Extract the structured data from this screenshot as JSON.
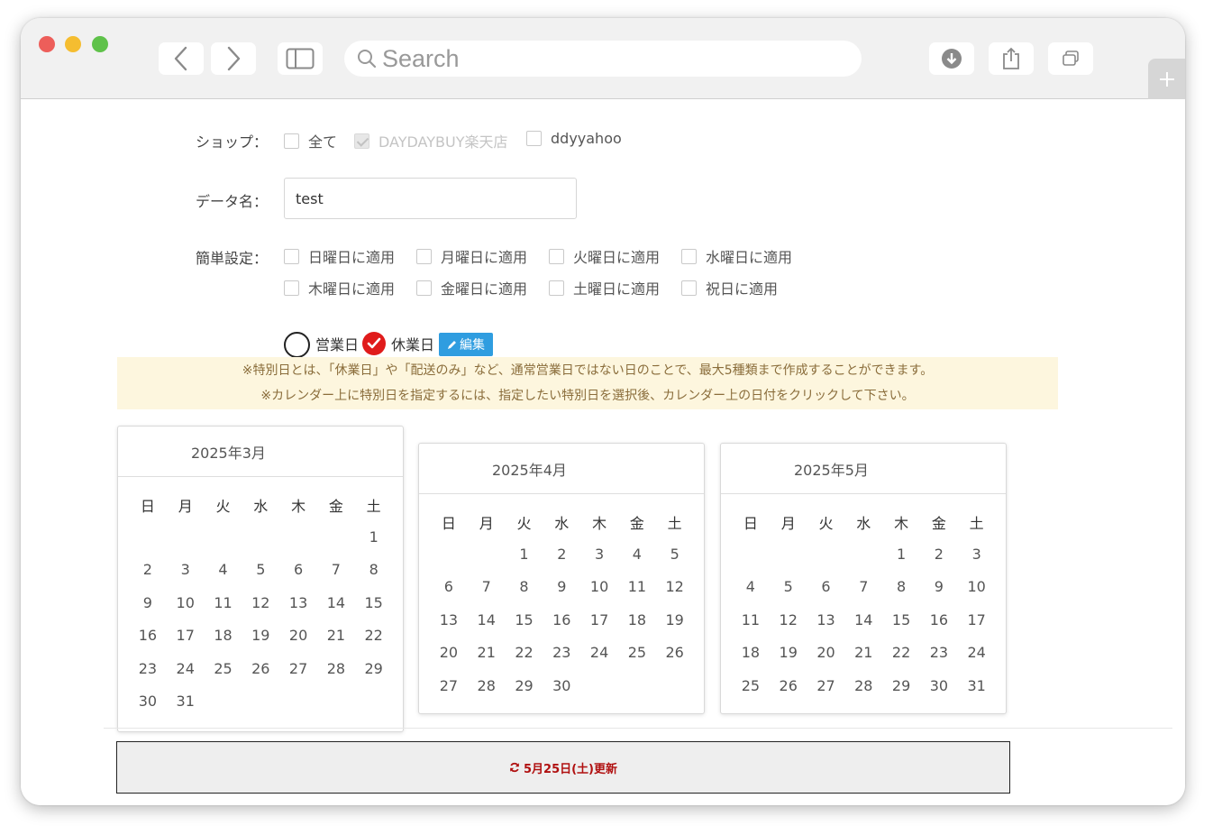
{
  "browser": {
    "search_placeholder": "Search"
  },
  "form": {
    "shop_label": "ショップ：",
    "shop_options": [
      {
        "label": "全て",
        "checked": false,
        "disabled": false
      },
      {
        "label": "DAYDAYBUY楽天店",
        "checked": true,
        "disabled": true
      },
      {
        "label": "ddyyahoo",
        "checked": false,
        "disabled": false
      }
    ],
    "data_name_label": "データ名：",
    "data_name_value": "test",
    "simple_setting_label": "簡単設定：",
    "simple_options": [
      "日曜日に適用",
      "月曜日に適用",
      "火曜日に適用",
      "水曜日に適用",
      "木曜日に適用",
      "金曜日に適用",
      "土曜日に適用",
      "祝日に適用"
    ],
    "day_type_business": "営業日",
    "day_type_holiday": "休業日",
    "day_type_selected": "休業日",
    "edit_button": "編集"
  },
  "notice": {
    "line1": "※特別日とは、「休業日」や「配送のみ」など、通常営業日ではない日のことで、最大5種類まで作成することができます。",
    "line2": "※カレンダー上に特別日を指定するには、指定したい特別日を選択後、カレンダー上の日付をクリックして下さい。"
  },
  "calendars": [
    {
      "title": "2025年3月",
      "weekdays": [
        "日",
        "月",
        "火",
        "水",
        "木",
        "金",
        "土"
      ],
      "weeks": [
        [
          "",
          "",
          "",
          "",
          "",
          "",
          "1"
        ],
        [
          "2",
          "3",
          "4",
          "5",
          "6",
          "7",
          "8"
        ],
        [
          "9",
          "10",
          "11",
          "12",
          "13",
          "14",
          "15"
        ],
        [
          "16",
          "17",
          "18",
          "19",
          "20",
          "21",
          "22"
        ],
        [
          "23",
          "24",
          "25",
          "26",
          "27",
          "28",
          "29"
        ],
        [
          "30",
          "31",
          "",
          "",
          "",
          "",
          ""
        ]
      ]
    },
    {
      "title": "2025年4月",
      "weekdays": [
        "日",
        "月",
        "火",
        "水",
        "木",
        "金",
        "土"
      ],
      "weeks": [
        [
          "",
          "",
          "1",
          "2",
          "3",
          "4",
          "5"
        ],
        [
          "6",
          "7",
          "8",
          "9",
          "10",
          "11",
          "12"
        ],
        [
          "13",
          "14",
          "15",
          "16",
          "17",
          "18",
          "19"
        ],
        [
          "20",
          "21",
          "22",
          "23",
          "24",
          "25",
          "26"
        ],
        [
          "27",
          "28",
          "29",
          "30",
          "",
          "",
          ""
        ]
      ]
    },
    {
      "title": "2025年5月",
      "weekdays": [
        "日",
        "月",
        "火",
        "水",
        "木",
        "金",
        "土"
      ],
      "weeks": [
        [
          "",
          "",
          "",
          "",
          "1",
          "2",
          "3"
        ],
        [
          "4",
          "5",
          "6",
          "7",
          "8",
          "9",
          "10"
        ],
        [
          "11",
          "12",
          "13",
          "14",
          "15",
          "16",
          "17"
        ],
        [
          "18",
          "19",
          "20",
          "21",
          "22",
          "23",
          "24"
        ],
        [
          "25",
          "26",
          "27",
          "28",
          "29",
          "30",
          "31"
        ]
      ]
    }
  ],
  "footer": {
    "update_label": "5月25日(土)更新",
    "update_color": "#b01010"
  }
}
